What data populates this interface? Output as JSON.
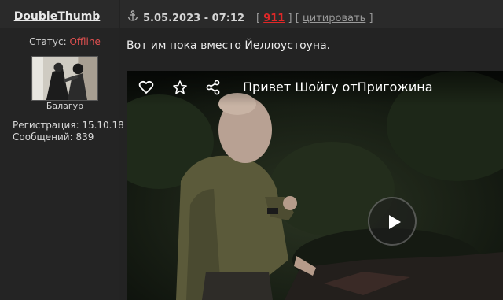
{
  "user": {
    "username": "DoubleThumb",
    "status_label": "Статус:",
    "status_value": "Offline",
    "rank": "Балагур",
    "registration": "Регистрация: 15.10.18",
    "messages": "Сообщений: 839"
  },
  "post": {
    "date": "5.05.2023 - 07:12",
    "rating_open": "[",
    "rating": "911",
    "rating_close": "]",
    "quote_open": "[",
    "quote_label": "цитировать",
    "quote_close": "]",
    "text": "Вот им пока вместо Йеллоустоуна."
  },
  "video": {
    "title": "Привет Шойгу отПригожина",
    "icons": [
      "heart-icon",
      "star-icon",
      "share-icon",
      "play-icon"
    ]
  },
  "colors": {
    "offline": "#e05050",
    "rating": "#e02828",
    "background": "#232323"
  }
}
